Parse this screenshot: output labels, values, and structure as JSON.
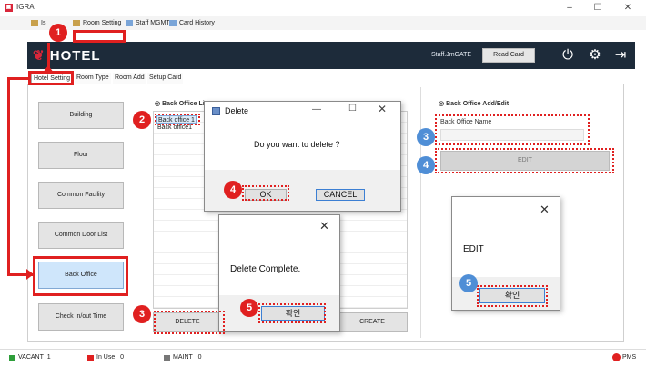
{
  "window": {
    "title": "IGRA",
    "minimize": "–",
    "maximize": "☐",
    "close": "✕",
    "accent": "#d9263a"
  },
  "menu": {
    "items": [
      "Is",
      "Room Setting",
      "Staff MGMT",
      "Card History"
    ]
  },
  "header": {
    "logo": "HOTEL",
    "staff": "Staff.JmGATE",
    "read_card": "Read Card",
    "icons": [
      "power-icon",
      "gear-icon",
      "logout-icon"
    ]
  },
  "tabs": [
    "Hotel Setting",
    "Room Type",
    "Room Add",
    "Setup Card"
  ],
  "sidebar": [
    "Building",
    "Floor",
    "Common Facility",
    "Common Door List",
    "Back Office",
    "Check In/out Time"
  ],
  "list_panel": {
    "title": "Back Office Lis",
    "items": [
      "Back office 1",
      "Back office1"
    ],
    "delete_label": "DELETE",
    "create_label": "CREATE"
  },
  "edit_panel": {
    "title": "Back Office Add/Edit",
    "field_label": "Back Office Name",
    "edit_button": "EDIT"
  },
  "delete_dialog": {
    "title": "Delete",
    "message": "Do you want to delete ?",
    "ok": "OK",
    "cancel": "CANCEL"
  },
  "complete_dialog": {
    "message": "Delete Complete.",
    "confirm": "확인"
  },
  "edit_dialog": {
    "message": "EDIT",
    "confirm": "확인"
  },
  "status": {
    "vacant_label": "VACANT",
    "vacant_count": "1",
    "inuse_label": "In Use",
    "inuse_count": "0",
    "maint_label": "MAINT",
    "maint_count": "0",
    "pms": "PMS",
    "colors": {
      "vacant": "#2e9e3a",
      "inuse": "#e02020",
      "maint": "#777777"
    }
  },
  "annotations": [
    "1",
    "2",
    "3",
    "4",
    "5",
    "3",
    "4",
    "5"
  ]
}
